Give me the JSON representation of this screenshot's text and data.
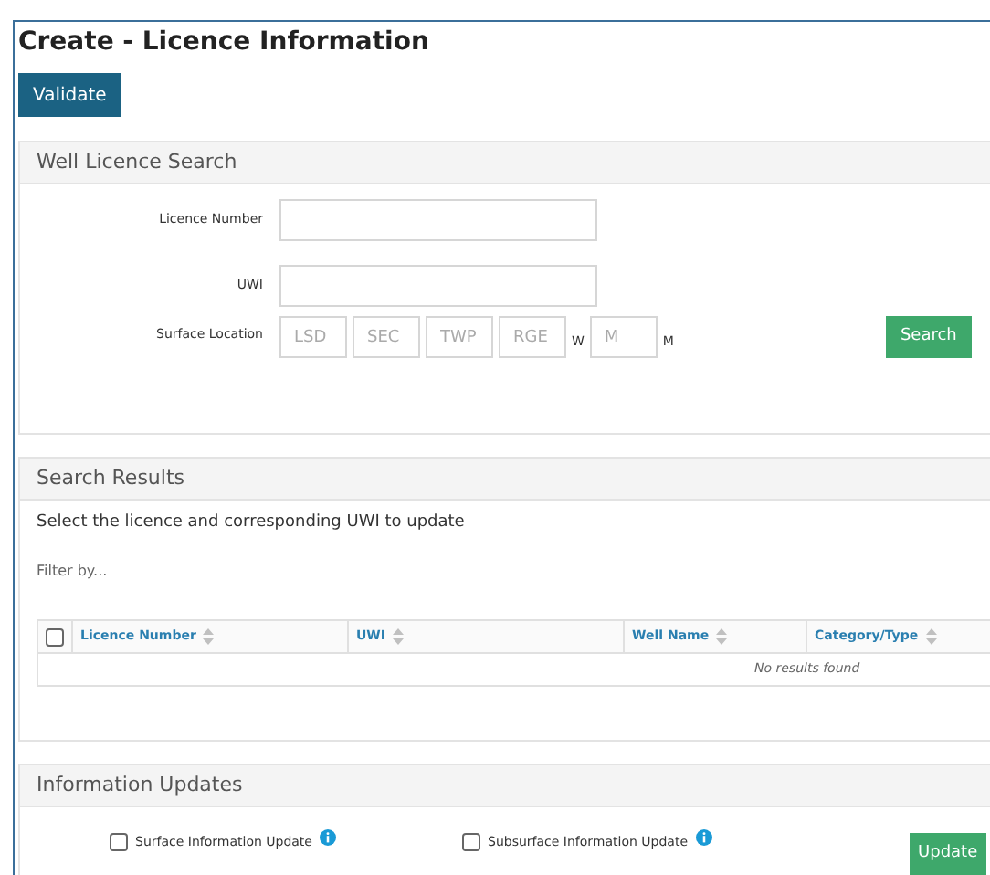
{
  "title": "Create - Licence Information",
  "validate_button": "Validate",
  "search_panel": {
    "title": "Well Licence Search",
    "fields": [
      {
        "label": "Licence Number"
      },
      {
        "label": "UWI"
      }
    ],
    "surface_location": {
      "label": "Surface Location",
      "parts": [
        {
          "kind": "input",
          "placeholder": "LSD"
        },
        {
          "kind": "input",
          "placeholder": "SEC"
        },
        {
          "kind": "input",
          "placeholder": "TWP"
        },
        {
          "kind": "input",
          "placeholder": "RGE"
        },
        {
          "kind": "text",
          "text": "W"
        },
        {
          "kind": "input",
          "placeholder": "M"
        },
        {
          "kind": "text",
          "text": "M"
        }
      ]
    },
    "search_button": "Search"
  },
  "results_panel": {
    "title": "Search Results",
    "instruction": "Select the licence and corresponding UWI to update",
    "filter": {
      "placeholder": "Filter by..."
    },
    "table": {
      "select_all": {
        "checked": false
      },
      "columns": [
        "Licence Number",
        "UWI",
        "Well Name",
        "Category/Type"
      ],
      "empty_message": "No results found"
    }
  },
  "updates_panel": {
    "title": "Information Updates",
    "options": [
      {
        "label": "Surface Information Update",
        "checked": false
      },
      {
        "label": "Subsurface Information Update",
        "checked": false
      }
    ],
    "update_button": "Update"
  }
}
